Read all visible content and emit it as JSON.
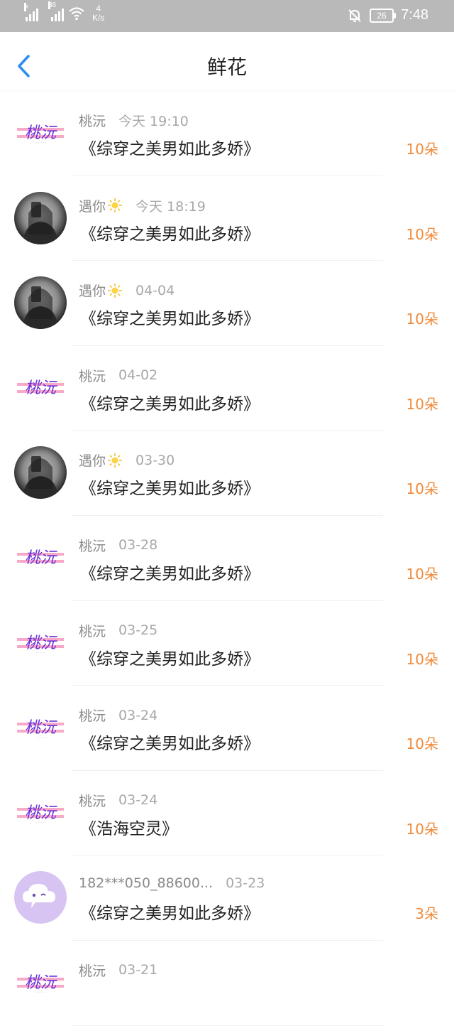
{
  "status_bar": {
    "signal_1_x": "×",
    "signal_2_label": "36",
    "speed_value": "4",
    "speed_unit": "K/s",
    "battery": "26",
    "time": "7:48"
  },
  "header": {
    "title": "鲜花"
  },
  "records": [
    {
      "avatar": "logo",
      "name": "桃沅",
      "badge": false,
      "time": "今天 19:10",
      "book": "《综穿之美男如此多娇》",
      "count": "10朵"
    },
    {
      "avatar": "photo",
      "name": "遇你",
      "badge": true,
      "time": "今天 18:19",
      "book": "《综穿之美男如此多娇》",
      "count": "10朵"
    },
    {
      "avatar": "photo",
      "name": "遇你",
      "badge": true,
      "time": "04-04",
      "book": "《综穿之美男如此多娇》",
      "count": "10朵"
    },
    {
      "avatar": "logo",
      "name": "桃沅",
      "badge": false,
      "time": "04-02",
      "book": "《综穿之美男如此多娇》",
      "count": "10朵"
    },
    {
      "avatar": "photo",
      "name": "遇你",
      "badge": true,
      "time": "03-30",
      "book": "《综穿之美男如此多娇》",
      "count": "10朵"
    },
    {
      "avatar": "logo",
      "name": "桃沅",
      "badge": false,
      "time": "03-28",
      "book": "《综穿之美男如此多娇》",
      "count": "10朵"
    },
    {
      "avatar": "logo",
      "name": "桃沅",
      "badge": false,
      "time": "03-25",
      "book": "《综穿之美男如此多娇》",
      "count": "10朵"
    },
    {
      "avatar": "logo",
      "name": "桃沅",
      "badge": false,
      "time": "03-24",
      "book": "《综穿之美男如此多娇》",
      "count": "10朵"
    },
    {
      "avatar": "logo",
      "name": "桃沅",
      "badge": false,
      "time": "03-24",
      "book": "《浩海空灵》",
      "count": "10朵"
    },
    {
      "avatar": "cloud",
      "name": "182***050_88600...",
      "badge": false,
      "time": "03-23",
      "book": "《综穿之美男如此多娇》",
      "count": "3朵"
    },
    {
      "avatar": "logo",
      "name": "桃沅",
      "badge": false,
      "time": "03-21",
      "book": "",
      "count": ""
    }
  ],
  "icons": {
    "back": "chevron-left-icon",
    "badge": "sun-icon",
    "mute": "bell-off-icon",
    "wifi": "wifi-icon"
  },
  "colors": {
    "accent_blue": "#2b8ef0",
    "flower_orange": "#f08a3a",
    "status_bar_bg": "#b9b9b9"
  }
}
